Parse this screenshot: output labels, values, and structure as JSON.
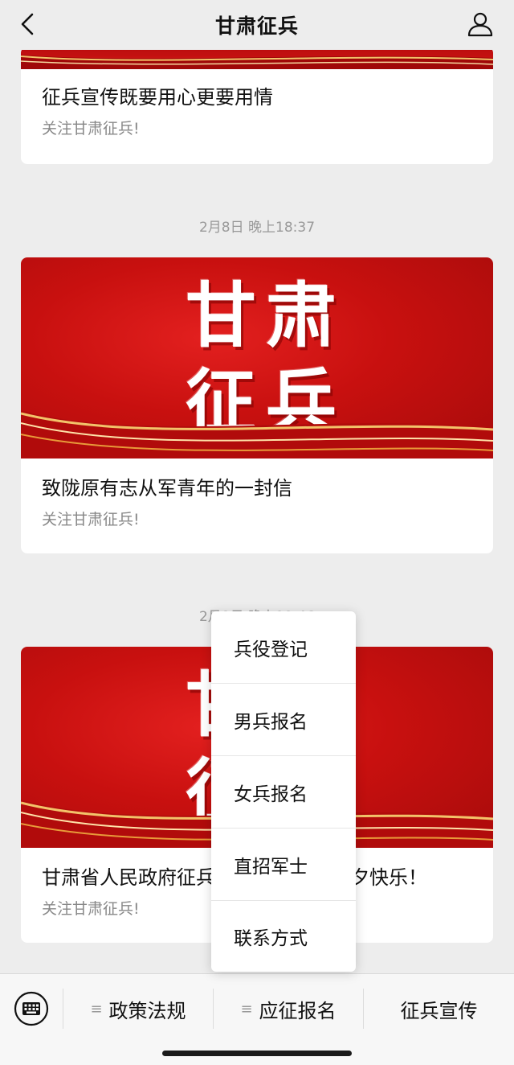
{
  "header": {
    "title": "甘肃征兵",
    "back_icon": "chevron-left-icon",
    "user_icon": "user-icon"
  },
  "articles": [
    {
      "title": "征兵宣传既要用心更要用情",
      "desc": "关注甘肃征兵!"
    },
    {
      "timestamp": "2月8日 晚上18:37",
      "banner_text_line1": "甘肃",
      "banner_text_line2": "征兵",
      "title": "致陇原有志从军青年的一封信",
      "desc": "关注甘肃征兵!"
    },
    {
      "timestamp": "2月9日 晚上19:46",
      "banner_text_line1": "甘肃",
      "banner_text_line2": "征兵",
      "title": "甘肃省人民政府征兵办公室祝大家除夕快乐！",
      "desc": "关注甘肃征兵!"
    }
  ],
  "popup_menu": {
    "items": [
      "兵役登记",
      "男兵报名",
      "女兵报名",
      "直招军士",
      "联系方式"
    ]
  },
  "bottom_menu": {
    "keyboard_icon": "keyboard-icon",
    "items": [
      "政策法规",
      "应征报名",
      "征兵宣传"
    ],
    "lines_glyph": "≡"
  },
  "colors": {
    "banner_red": "#c8100f",
    "ribbon_gold": "#f3c36a",
    "background": "#ededed"
  }
}
